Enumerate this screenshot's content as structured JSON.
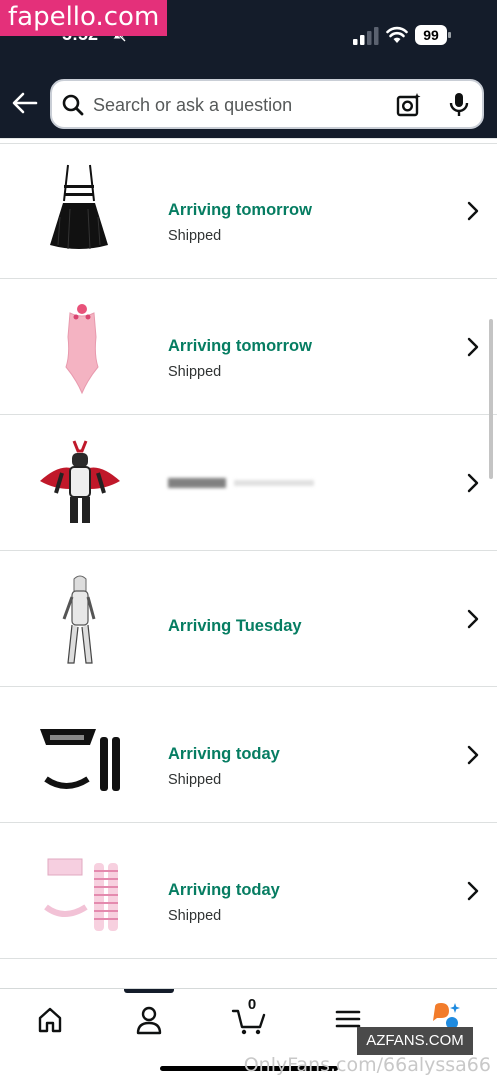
{
  "status_bar": {
    "time": "5:52",
    "battery": "99"
  },
  "search": {
    "placeholder": "Search or ask a question"
  },
  "orders": [
    {
      "status": "Arriving tomorrow",
      "sub": "Shipped"
    },
    {
      "status": "Arriving tomorrow",
      "sub": "Shipped"
    },
    {
      "status": "",
      "sub": ""
    },
    {
      "status": "Arriving Tuesday",
      "sub": ""
    },
    {
      "status": "Arriving today",
      "sub": "Shipped"
    },
    {
      "status": "Arriving today",
      "sub": "Shipped"
    }
  ],
  "bottom_nav": {
    "cart_count": "0",
    "items": [
      "home-icon",
      "account-icon",
      "cart-icon",
      "menu-icon",
      "assistant-icon"
    ]
  },
  "watermarks": {
    "top": "fapello.com",
    "badge": "AZFANS.COM",
    "bottom": "OnlyFans.com/66alyssa66"
  },
  "colors": {
    "header_bg": "#141c2a",
    "status_green": "#067d62",
    "assistant_orange": "#f27c2b",
    "assistant_blue": "#1f8be0"
  }
}
